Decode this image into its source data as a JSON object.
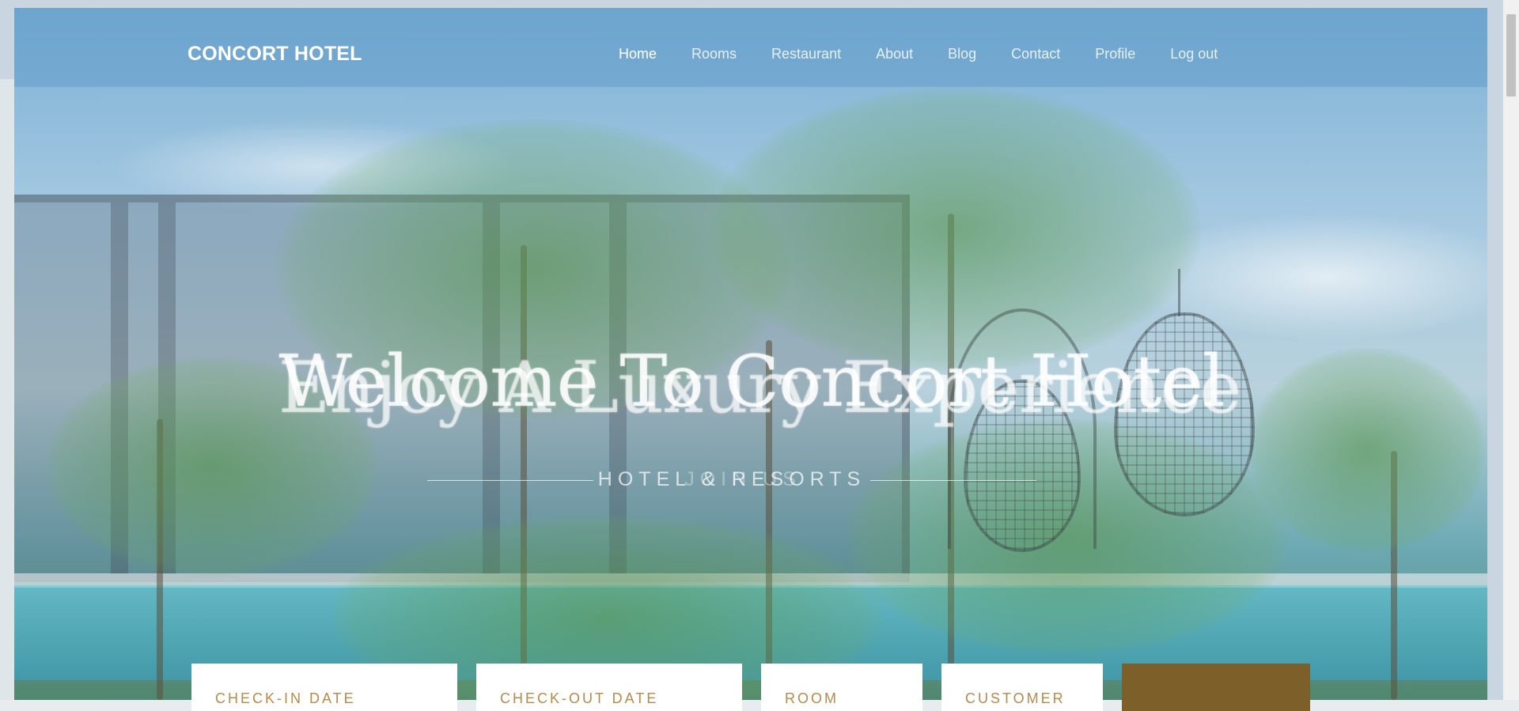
{
  "header": {
    "logo": "CONCORT HOTEL",
    "nav": [
      {
        "label": "Home",
        "active": true
      },
      {
        "label": "Rooms",
        "active": false
      },
      {
        "label": "Restaurant",
        "active": false
      },
      {
        "label": "About",
        "active": false
      },
      {
        "label": "Blog",
        "active": false
      },
      {
        "label": "Contact",
        "active": false
      },
      {
        "label": "Profile",
        "active": false
      },
      {
        "label": "Log out",
        "active": false
      }
    ]
  },
  "hero": {
    "title_primary": "Welcome To Concort Hotel",
    "title_secondary": "Enjoy A Luxury Experience",
    "subtitle_primary": "HOTEL & RESORTS",
    "subtitle_secondary": "JOIN US"
  },
  "booking": {
    "checkin_label": "CHECK-IN DATE",
    "checkout_label": "CHECK-OUT DATE",
    "room_label": "ROOM",
    "customer_label": "CUSTOMER"
  },
  "colors": {
    "accent": "#b88a4a",
    "button": "#7d5f2a"
  }
}
